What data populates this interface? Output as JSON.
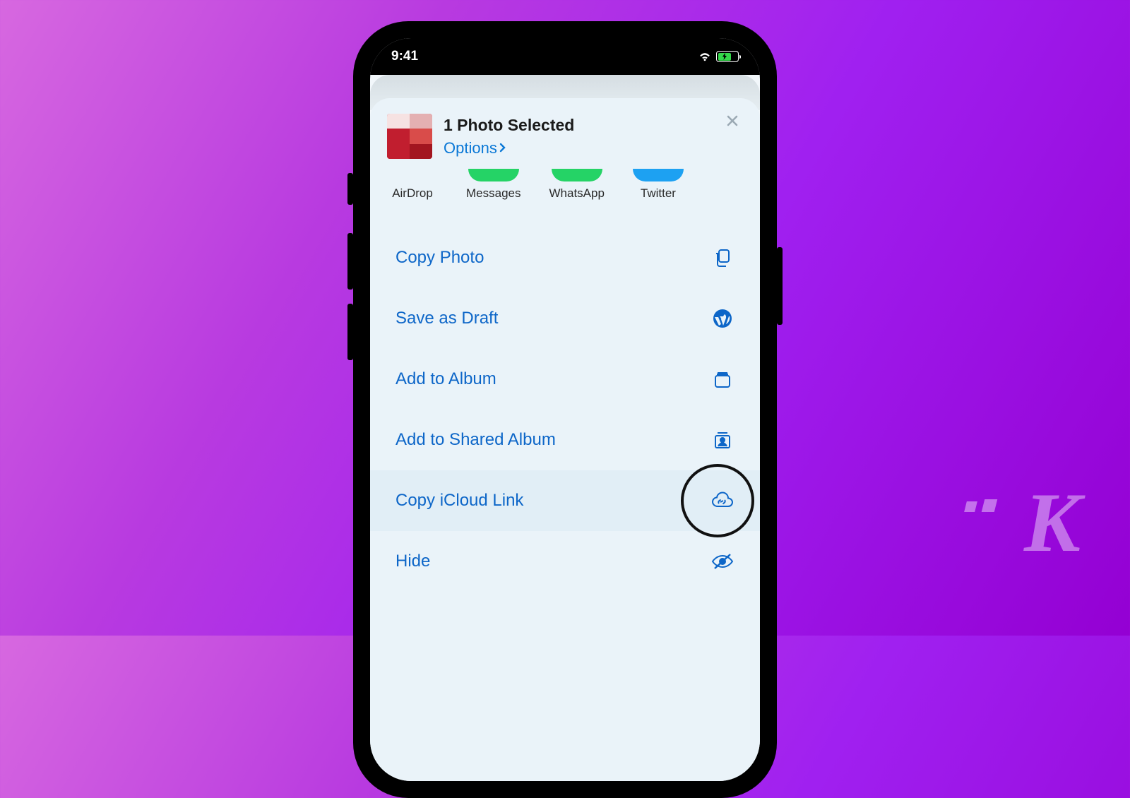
{
  "status": {
    "time": "9:41"
  },
  "sheet": {
    "title": "1 Photo Selected",
    "options_label": "Options"
  },
  "share_apps": [
    {
      "label": "AirDrop",
      "icon": "none"
    },
    {
      "label": "Messages",
      "icon": "green"
    },
    {
      "label": "WhatsApp",
      "icon": "green"
    },
    {
      "label": "Twitter",
      "icon": "blue"
    }
  ],
  "actions": [
    {
      "label": "Copy Photo",
      "icon": "copy-icon"
    },
    {
      "label": "Save as Draft",
      "icon": "wordpress-icon"
    },
    {
      "label": "Add to Album",
      "icon": "album-icon"
    },
    {
      "label": "Add to Shared Album",
      "icon": "shared-album-icon"
    },
    {
      "label": "Copy iCloud Link",
      "icon": "cloud-link-icon",
      "highlighted": true
    },
    {
      "label": "Hide",
      "icon": "eye-slash-icon"
    }
  ]
}
